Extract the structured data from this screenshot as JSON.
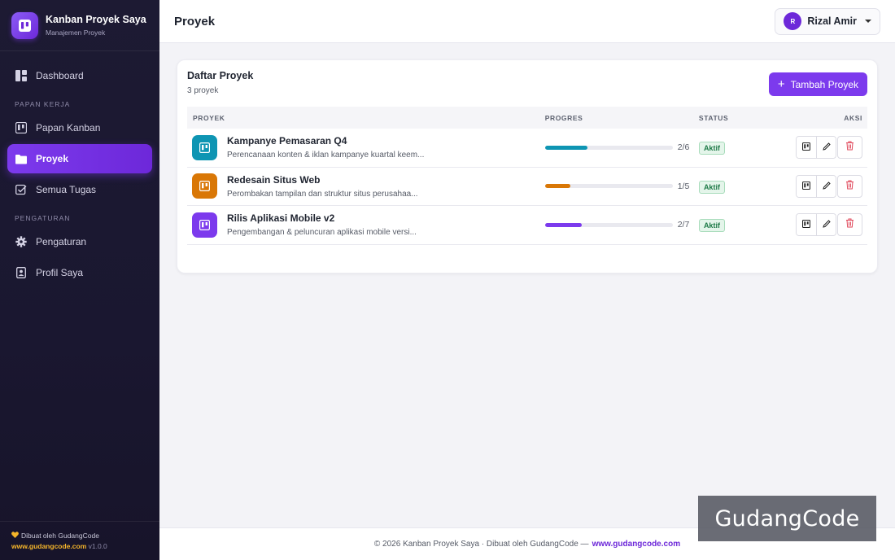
{
  "brand": {
    "title": "Kanban Proyek Saya",
    "subtitle": "Manajemen Proyek"
  },
  "nav": {
    "dashboard": "Dashboard",
    "section_work": "PAPAN KERJA",
    "kanban": "Papan Kanban",
    "projects": "Proyek",
    "tasks": "Semua Tugas",
    "section_settings": "PENGATURAN",
    "settings": "Pengaturan",
    "profile": "Profil Saya"
  },
  "sidebar_footer": {
    "made_by": "Dibuat oleh GudangCode",
    "site": "www.gudangcode.com",
    "version": "v1.0.0"
  },
  "header": {
    "title": "Proyek",
    "user_initial": "R",
    "user_name": "Rizal Amir"
  },
  "card": {
    "title": "Daftar Proyek",
    "subtitle": "3 proyek",
    "add_button": "Tambah Proyek",
    "columns": {
      "project": "PROYEK",
      "progress": "PROGRES",
      "status": "STATUS",
      "actions": "AKSI"
    }
  },
  "projects": [
    {
      "name": "Kampanye Pemasaran Q4",
      "description": "Perencanaan konten & iklan kampanye kuartal keem...",
      "progress_text": "2/6",
      "progress": 0.333,
      "status": "Aktif",
      "color": "#0e95b3"
    },
    {
      "name": "Redesain Situs Web",
      "description": "Perombakan tampilan dan struktur situs perusahaa...",
      "progress_text": "1/5",
      "progress": 0.2,
      "status": "Aktif",
      "color": "#d97706"
    },
    {
      "name": "Rilis Aplikasi Mobile v2",
      "description": "Pengembangan & peluncuran aplikasi mobile versi...",
      "progress_text": "2/7",
      "progress": 0.286,
      "status": "Aktif",
      "color": "#7c3aed"
    }
  ],
  "footer": {
    "text": "© 2026 Kanban Proyek Saya · Dibuat oleh GudangCode —",
    "link": "www.gudangcode.com"
  },
  "watermark": "GudangCode",
  "colors": {
    "accent": "#7c3aed",
    "sidebar_bg": "#1d1a33",
    "success": "#1e7a47",
    "danger": "#e0475a"
  }
}
